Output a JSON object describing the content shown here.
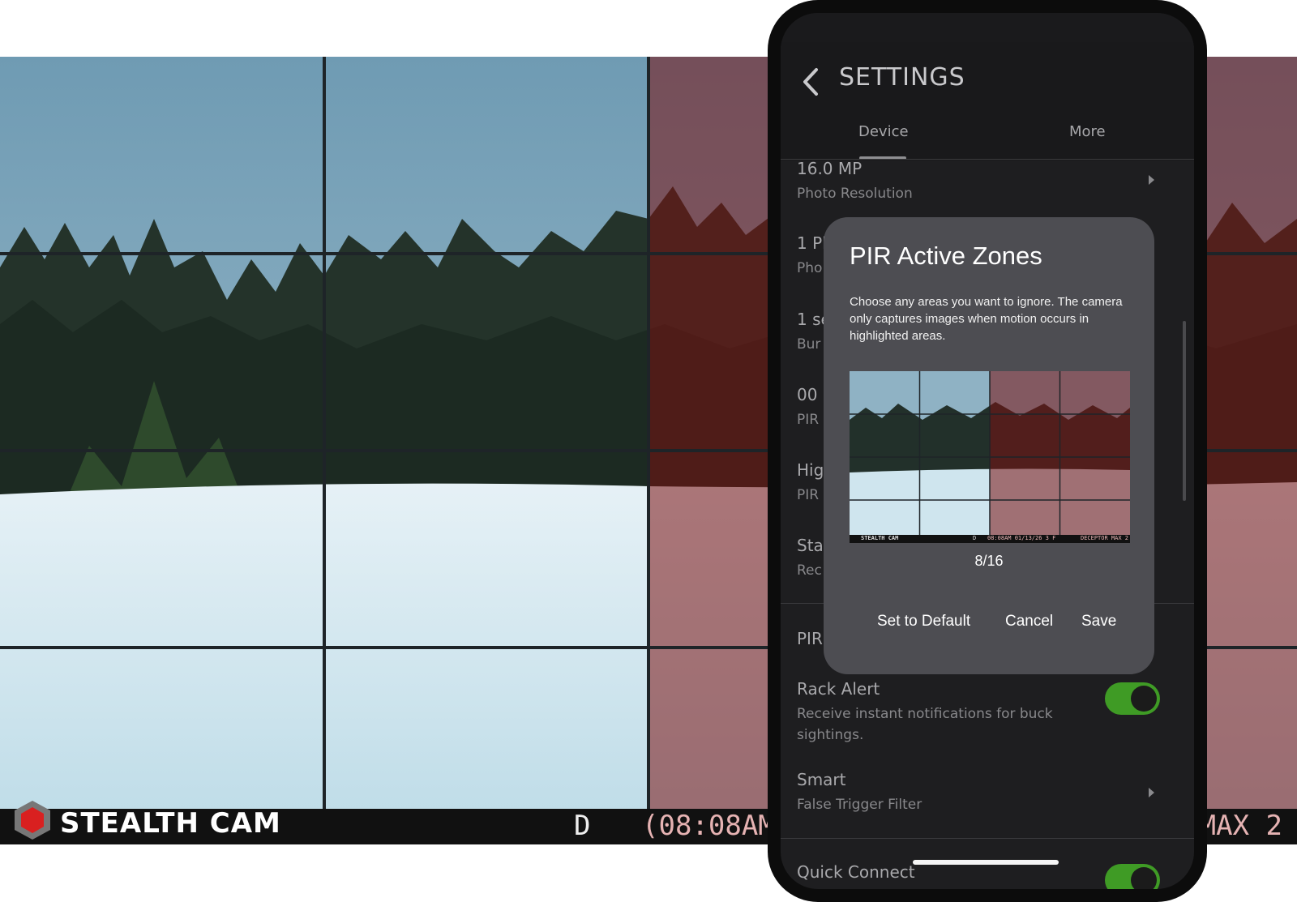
{
  "background_overlay": {
    "brand": "STEALTH CAM",
    "day_night": "D",
    "time_fragment": "(08:08AM",
    "model_fragment": "MAX 2",
    "active_zone_color": "#aee0f0",
    "ignored_zone_color": "#7a1010"
  },
  "header": {
    "title": "SETTINGS",
    "tabs": [
      {
        "label": "Device",
        "selected": true
      },
      {
        "label": "More",
        "selected": false
      }
    ]
  },
  "settings": [
    {
      "value": "16.0 MP",
      "label": "Photo Resolution"
    },
    {
      "value": "1 Ph",
      "label": "Pho"
    },
    {
      "value": "1 se",
      "label": "Bur"
    },
    {
      "value": "00",
      "label": "PIR"
    },
    {
      "value": "Hig",
      "label": "PIR"
    },
    {
      "value": "Sta",
      "label": "Rec"
    },
    {
      "value": "PIR",
      "label": ""
    }
  ],
  "rack_alert": {
    "title": "Rack Alert",
    "description": "Receive instant notifications for buck sightings.",
    "enabled": true
  },
  "smart": {
    "title": "Smart",
    "label": "False Trigger Filter"
  },
  "quick_connect": {
    "title": "Quick Connect",
    "enabled": true
  },
  "dialog": {
    "title": "PIR Active Zones",
    "description": "Choose any areas you want to ignore. The camera only captures images when motion occurs in highlighted areas.",
    "count": "8/16",
    "buttons": {
      "default": "Set to Default",
      "cancel": "Cancel",
      "save": "Save"
    },
    "preview_overlay": {
      "brand": "STEALTH CAM",
      "day_night": "D",
      "stamp": "08:08AM 01/13/26  3 F",
      "model": "DECEPTOR MAX 2"
    }
  }
}
